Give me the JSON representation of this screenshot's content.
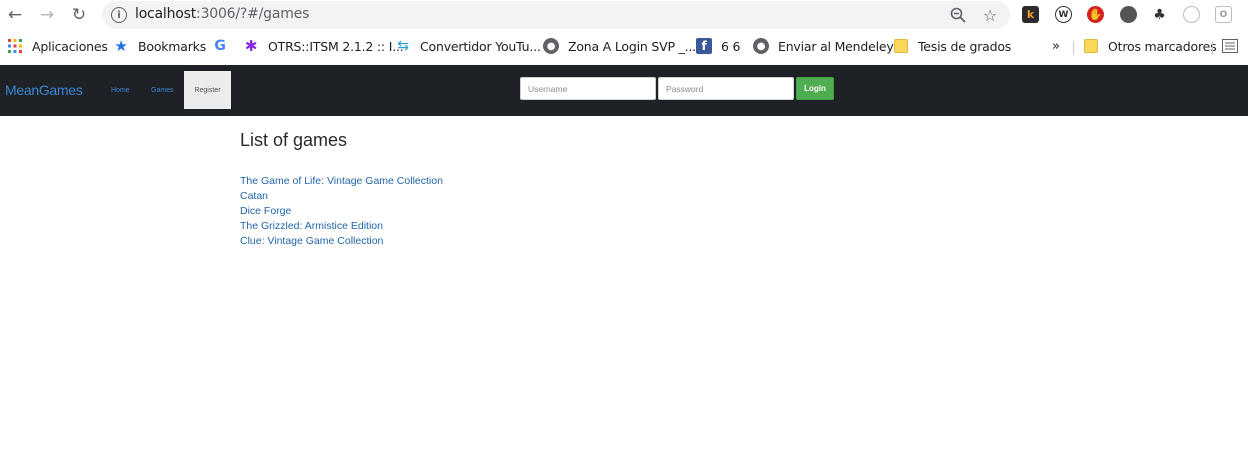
{
  "browser": {
    "url_host": "localhost",
    "url_rest": ":3006/?#/games",
    "bookmarks": [
      {
        "label": "Aplicaciones",
        "icon": "apps-grid-icon"
      },
      {
        "label": "Bookmarks",
        "icon": "star-icon"
      },
      {
        "label": "",
        "icon": "google-icon"
      },
      {
        "label": "OTRS::ITSM 2.1.2 :: I...",
        "icon": "otrs-icon"
      },
      {
        "label": "Convertidor YouTu...",
        "icon": "converter-icon"
      },
      {
        "label": "Zona A Login SVP _...",
        "icon": "globe-icon"
      },
      {
        "label": "6 6",
        "icon": "facebook-icon"
      },
      {
        "label": "Enviar al Mendeley",
        "icon": "globe-icon"
      },
      {
        "label": "Tesis de grados",
        "icon": "folder-icon"
      }
    ],
    "more_bookmarks": "»",
    "other_bookmarks": "Otros marcadores"
  },
  "app": {
    "brand": "MeanGames",
    "nav": {
      "home": "Home",
      "games": "Games",
      "register": "Register"
    },
    "login": {
      "username_placeholder": "Username",
      "password_placeholder": "Password",
      "button": "Login"
    }
  },
  "content": {
    "title": "List of games",
    "games": [
      "The Game of Life: Vintage Game Collection",
      "Catan",
      "Dice Forge",
      "The Grizzled: Armistice Edition",
      "Clue: Vintage Game Collection"
    ]
  },
  "colors": {
    "navbar_bg": "#1e2125",
    "link": "#2266aa",
    "brand": "#3a86d4",
    "login_button": "#4fae4f"
  }
}
